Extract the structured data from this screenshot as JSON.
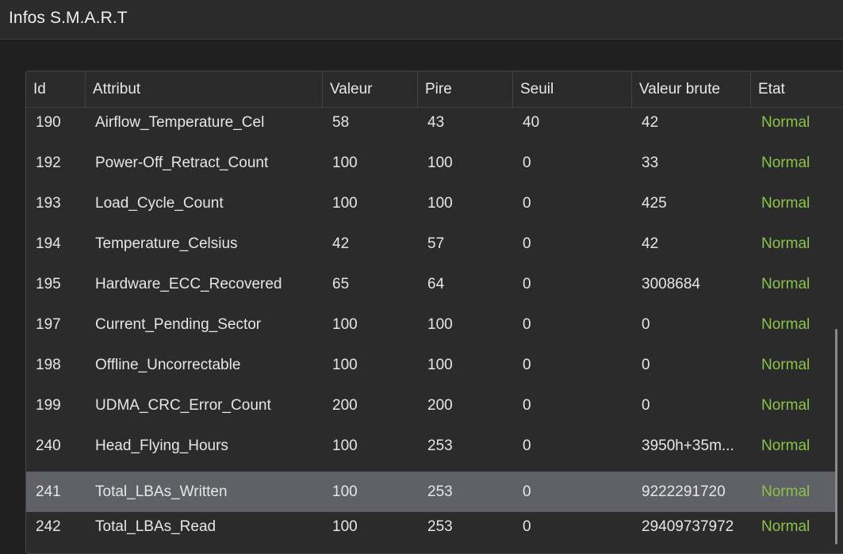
{
  "window": {
    "title": "Infos S.M.A.R.T"
  },
  "table": {
    "headers": [
      "Id",
      "Attribut",
      "Valeur",
      "Pire",
      "Seuil",
      "Valeur brute",
      "Etat"
    ],
    "rows": [
      {
        "id": "190",
        "attr": "Airflow_Temperature_Cel",
        "value": "58",
        "worst": "43",
        "threshold": "40",
        "raw": "42",
        "state": "Normal"
      },
      {
        "id": "192",
        "attr": "Power-Off_Retract_Count",
        "value": "100",
        "worst": "100",
        "threshold": "0",
        "raw": "33",
        "state": "Normal"
      },
      {
        "id": "193",
        "attr": "Load_Cycle_Count",
        "value": "100",
        "worst": "100",
        "threshold": "0",
        "raw": "425",
        "state": "Normal"
      },
      {
        "id": "194",
        "attr": "Temperature_Celsius",
        "value": "42",
        "worst": "57",
        "threshold": "0",
        "raw": "42",
        "state": "Normal"
      },
      {
        "id": "195",
        "attr": "Hardware_ECC_Recovered",
        "value": "65",
        "worst": "64",
        "threshold": "0",
        "raw": "3008684",
        "state": "Normal"
      },
      {
        "id": "197",
        "attr": "Current_Pending_Sector",
        "value": "100",
        "worst": "100",
        "threshold": "0",
        "raw": "0",
        "state": "Normal"
      },
      {
        "id": "198",
        "attr": "Offline_Uncorrectable",
        "value": "100",
        "worst": "100",
        "threshold": "0",
        "raw": "0",
        "state": "Normal"
      },
      {
        "id": "199",
        "attr": "UDMA_CRC_Error_Count",
        "value": "200",
        "worst": "200",
        "threshold": "0",
        "raw": "0",
        "state": "Normal"
      },
      {
        "id": "240",
        "attr": "Head_Flying_Hours",
        "value": "100",
        "worst": "253",
        "threshold": "0",
        "raw": "3950h+35m...",
        "state": "Normal"
      },
      {
        "id": "241",
        "attr": "Total_LBAs_Written",
        "value": "100",
        "worst": "253",
        "threshold": "0",
        "raw": "9222291720",
        "state": "Normal",
        "selected": true
      },
      {
        "id": "242",
        "attr": "Total_LBAs_Read",
        "value": "100",
        "worst": "253",
        "threshold": "0",
        "raw": "29409737972",
        "state": "Normal"
      }
    ]
  },
  "colors": {
    "status_normal": "#8bc34a",
    "selected_row": "#5f6166"
  }
}
